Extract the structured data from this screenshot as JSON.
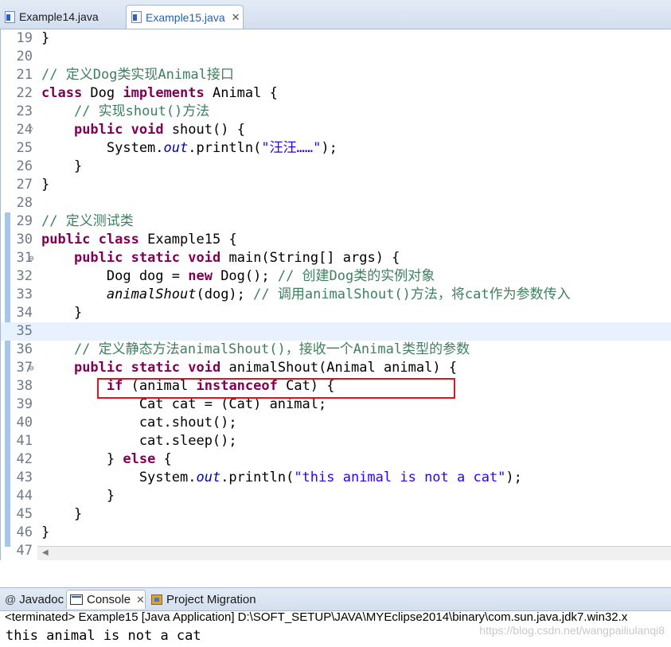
{
  "editor_tabs": [
    {
      "label": "Example14.java",
      "active": false
    },
    {
      "label": "Example15.java",
      "active": true,
      "close": "✕"
    }
  ],
  "code_lines": [
    {
      "num": "19",
      "tokens": [
        {
          "t": "}",
          "c": ""
        }
      ]
    },
    {
      "num": "20",
      "tokens": []
    },
    {
      "num": "21",
      "tokens": [
        {
          "t": "// 定义Dog类实现Animal接口",
          "c": "cm"
        }
      ]
    },
    {
      "num": "22",
      "tokens": [
        {
          "t": "class",
          "c": "kw"
        },
        {
          "t": " Dog ",
          "c": ""
        },
        {
          "t": "implements",
          "c": "kw"
        },
        {
          "t": " Animal {",
          "c": ""
        }
      ]
    },
    {
      "num": "23",
      "tokens": [
        {
          "t": "    // 实现shout()方法",
          "c": "cm"
        }
      ]
    },
    {
      "num": "24",
      "fold": "⌃",
      "tokens": [
        {
          "t": "    ",
          "c": ""
        },
        {
          "t": "public",
          "c": "kw"
        },
        {
          "t": " ",
          "c": ""
        },
        {
          "t": "void",
          "c": "kw"
        },
        {
          "t": " shout() {",
          "c": ""
        }
      ]
    },
    {
      "num": "25",
      "tokens": [
        {
          "t": "        System.",
          "c": ""
        },
        {
          "t": "out",
          "c": "fi"
        },
        {
          "t": ".println(",
          "c": ""
        },
        {
          "t": "\"汪汪……\"",
          "c": "st"
        },
        {
          "t": ");",
          "c": ""
        }
      ]
    },
    {
      "num": "26",
      "tokens": [
        {
          "t": "    }",
          "c": ""
        }
      ]
    },
    {
      "num": "27",
      "tokens": [
        {
          "t": "}",
          "c": ""
        }
      ]
    },
    {
      "num": "28",
      "tokens": []
    },
    {
      "num": "29",
      "tokens": [
        {
          "t": "// 定义测试类",
          "c": "cm"
        }
      ]
    },
    {
      "num": "30",
      "tokens": [
        {
          "t": "public",
          "c": "kw"
        },
        {
          "t": " ",
          "c": ""
        },
        {
          "t": "class",
          "c": "kw"
        },
        {
          "t": " Example15 {",
          "c": ""
        }
      ]
    },
    {
      "num": "31",
      "fold": "⊖",
      "tokens": [
        {
          "t": "    ",
          "c": ""
        },
        {
          "t": "public",
          "c": "kw"
        },
        {
          "t": " ",
          "c": ""
        },
        {
          "t": "static",
          "c": "kw"
        },
        {
          "t": " ",
          "c": ""
        },
        {
          "t": "void",
          "c": "kw"
        },
        {
          "t": " main(String[] args) {",
          "c": ""
        }
      ]
    },
    {
      "num": "32",
      "tokens": [
        {
          "t": "        Dog dog = ",
          "c": ""
        },
        {
          "t": "new",
          "c": "kw"
        },
        {
          "t": " Dog(); ",
          "c": ""
        },
        {
          "t": "// 创建Dog类的实例对象",
          "c": "cm"
        }
      ]
    },
    {
      "num": "33",
      "tokens": [
        {
          "t": "        ",
          "c": ""
        },
        {
          "t": "animalShout",
          "c": "it"
        },
        {
          "t": "(dog); ",
          "c": ""
        },
        {
          "t": "// 调用animalShout()方法，将cat作为参数传入",
          "c": "cm"
        }
      ]
    },
    {
      "num": "34",
      "tokens": [
        {
          "t": "    }",
          "c": ""
        }
      ]
    },
    {
      "num": "35",
      "current": true,
      "tokens": []
    },
    {
      "num": "36",
      "tokens": [
        {
          "t": "    // 定义静态方法animalShout()，接收一个Animal类型的参数",
          "c": "cm"
        }
      ]
    },
    {
      "num": "37",
      "fold": "⊖",
      "tokens": [
        {
          "t": "    ",
          "c": ""
        },
        {
          "t": "public",
          "c": "kw"
        },
        {
          "t": " ",
          "c": ""
        },
        {
          "t": "static",
          "c": "kw"
        },
        {
          "t": " ",
          "c": ""
        },
        {
          "t": "void",
          "c": "kw"
        },
        {
          "t": " animalShout(Animal animal) {",
          "c": ""
        }
      ]
    },
    {
      "num": "38",
      "tokens": [
        {
          "t": "        ",
          "c": ""
        },
        {
          "t": "if",
          "c": "kw"
        },
        {
          "t": " (animal ",
          "c": ""
        },
        {
          "t": "instanceof",
          "c": "kw"
        },
        {
          "t": " Cat) {",
          "c": ""
        }
      ]
    },
    {
      "num": "39",
      "tokens": [
        {
          "t": "            Cat cat = (Cat) animal;",
          "c": ""
        }
      ]
    },
    {
      "num": "40",
      "tokens": [
        {
          "t": "            cat.shout();",
          "c": ""
        }
      ]
    },
    {
      "num": "41",
      "tokens": [
        {
          "t": "            cat.sleep();",
          "c": ""
        }
      ]
    },
    {
      "num": "42",
      "tokens": [
        {
          "t": "        } ",
          "c": ""
        },
        {
          "t": "else",
          "c": "kw"
        },
        {
          "t": " {",
          "c": ""
        }
      ]
    },
    {
      "num": "43",
      "tokens": [
        {
          "t": "            System.",
          "c": ""
        },
        {
          "t": "out",
          "c": "fi"
        },
        {
          "t": ".println(",
          "c": ""
        },
        {
          "t": "\"this animal is not a cat\"",
          "c": "st"
        },
        {
          "t": ");",
          "c": ""
        }
      ]
    },
    {
      "num": "44",
      "tokens": [
        {
          "t": "        }",
          "c": ""
        }
      ]
    },
    {
      "num": "45",
      "tokens": [
        {
          "t": "    }",
          "c": ""
        }
      ]
    },
    {
      "num": "46",
      "tokens": [
        {
          "t": "}",
          "c": ""
        }
      ]
    },
    {
      "num": "47",
      "tokens": []
    }
  ],
  "panel_tabs": {
    "javadoc": "Javadoc",
    "console": "Console",
    "console_close": "✕",
    "migration": "Project Migration"
  },
  "console": {
    "status": "<terminated> Example15 [Java Application] D:\\SOFT_SETUP\\JAVA\\MYEclipse2014\\binary\\com.sun.java.jdk7.win32.x",
    "output": "this animal is not a cat"
  },
  "watermark": "https://blog.csdn.net/wangpailiulanqi8",
  "colors": {
    "keyword": "#7f0055",
    "comment": "#3f7f5f",
    "string": "#2a00ff",
    "field": "#0000c0",
    "highlight_box": "#e0141c"
  }
}
